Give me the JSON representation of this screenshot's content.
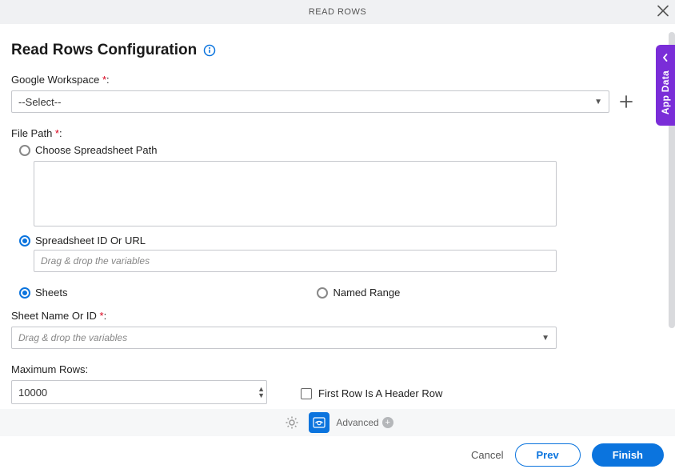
{
  "header": {
    "title": "READ ROWS"
  },
  "page": {
    "title": "Read Rows Configuration"
  },
  "sideTab": {
    "label": "App Data"
  },
  "labels": {
    "googleWorkspace": "Google Workspace ",
    "filePath": "File Path ",
    "chooseSpreadsheetPath": "Choose Spreadsheet Path",
    "spreadsheetIdOrUrl": "Spreadsheet ID Or URL",
    "sheets": "Sheets",
    "namedRange": "Named Range",
    "sheetNameOrId": "Sheet Name Or ID ",
    "maximumRows": "Maximum Rows:",
    "firstRowHeader": "First Row Is A Header Row"
  },
  "required": {
    "mark": "*",
    "colon": ":"
  },
  "values": {
    "googleWorkspaceSelected": "--Select--",
    "spreadsheetUrlPlaceholder": "Drag & drop the variables",
    "sheetNameOrIdPlaceholder": "Drag & drop the variables",
    "maximumRows": "10000"
  },
  "toolbar": {
    "advanced": "Advanced"
  },
  "footer": {
    "cancel": "Cancel",
    "prev": "Prev",
    "finish": "Finish"
  }
}
